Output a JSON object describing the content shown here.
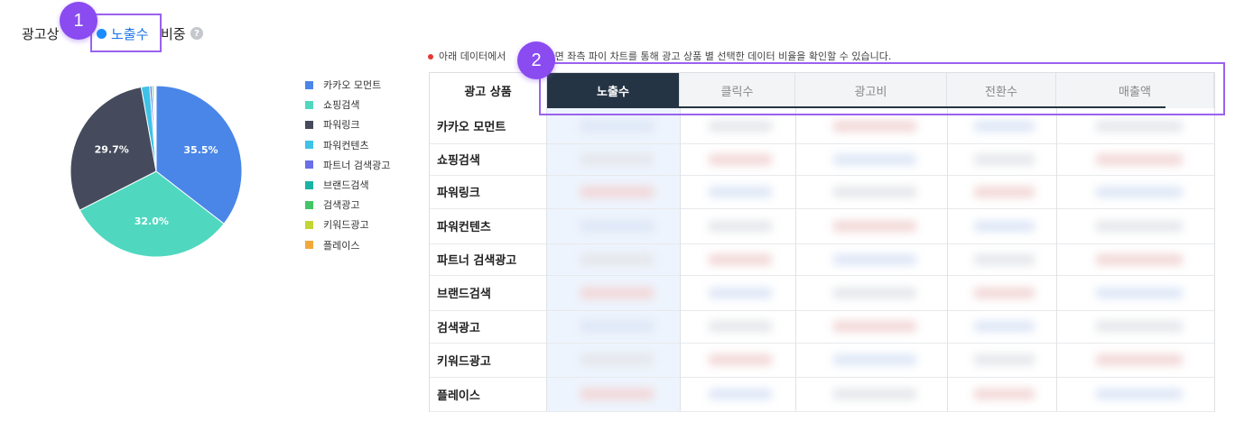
{
  "header": {
    "title_prefix": "광고상",
    "selected_metric": "노출수",
    "title_suffix": "비중",
    "help_icon": "question-circle-icon",
    "help_glyph": "?"
  },
  "badges": [
    "1",
    "2"
  ],
  "colors": {
    "accent": "#1a73e8",
    "active_tab": "#253444",
    "highlight": "#9a62ef",
    "badge": "#8a4bf0"
  },
  "chart_data": {
    "type": "pie",
    "categories": [
      "카카오 모먼트",
      "쇼핑검색",
      "파워링크",
      "파워컨텐츠",
      "파트너 검색광고",
      "브랜드검색",
      "검색광고",
      "키워드광고",
      "플레이스"
    ],
    "values": [
      35.5,
      32.0,
      29.7,
      1.6,
      0.4,
      0.3,
      0.2,
      0.2,
      0.1
    ],
    "labels": [
      "35.5%",
      "32.0%",
      "29.7%"
    ],
    "colors": [
      "#4a86e8",
      "#4fd8bf",
      "#454b5c",
      "#3ec2e8",
      "#6a6ee8",
      "#1ab3a3",
      "#43c565",
      "#c3d534",
      "#f2a93b"
    ],
    "legend_position": "right"
  },
  "note": {
    "text_before": "아래 데이터에서",
    "text_after": "릭하면 좌측 파이 차트를 통해 광고 상품 별 선택한 데이터 비율을 확인할 수 있습니다."
  },
  "table": {
    "columns": [
      "광고 상품",
      "노출수",
      "클릭수",
      "광고비",
      "전환수",
      "매출액"
    ],
    "active_column": "노출수",
    "rows": [
      "카카오 모먼트",
      "쇼핑검색",
      "파워링크",
      "파워컨텐츠",
      "파트너 검색광고",
      "브랜드검색",
      "검색광고",
      "키워드광고",
      "플레이스"
    ]
  }
}
